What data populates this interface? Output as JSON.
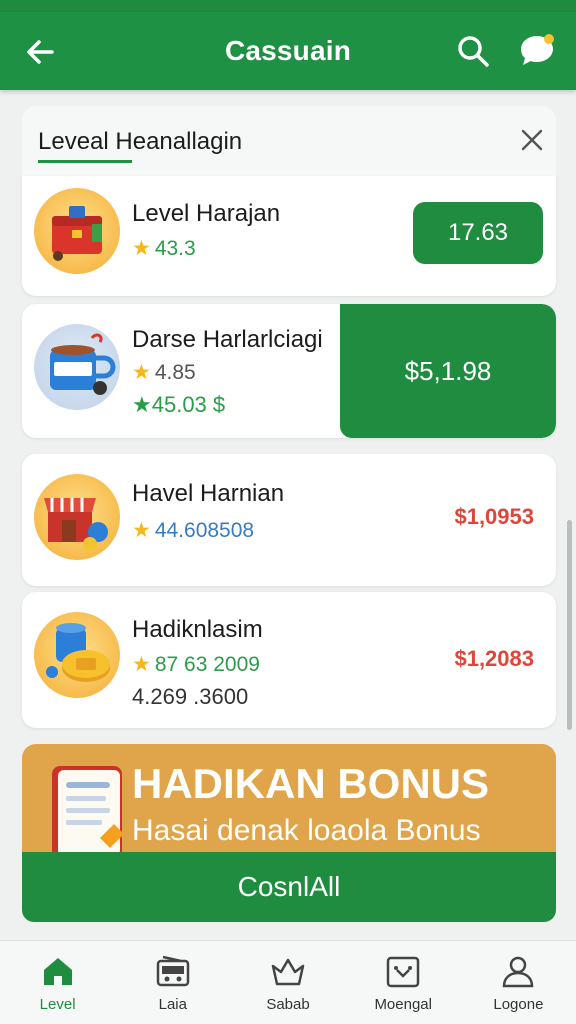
{
  "appbar": {
    "title": "Cassuain"
  },
  "search": {
    "query": "Leveal Heanallagin"
  },
  "items": [
    {
      "name": "Level Harajan",
      "rating": "43.3",
      "price": "17.63"
    },
    {
      "name": "Darse Harlarlciagi",
      "rating": "4.85",
      "sub": "45.03 $",
      "price": "$5,1.98"
    },
    {
      "name": "Havel Harnian",
      "rating": "44.608508",
      "price": "$1,0953"
    },
    {
      "name": "Hadiknlasim",
      "rating": "87 63 2009",
      "sub": "4.269 .3600",
      "price": "$1,2083"
    }
  ],
  "bonus": {
    "title": "HADIKAN BONUS",
    "subtitle": "Hasai denak loaola Bonus"
  },
  "cta": {
    "label": "CosnlAll"
  },
  "nav": [
    {
      "label": "Level",
      "icon": "home-icon"
    },
    {
      "label": "Laia",
      "icon": "radio-icon"
    },
    {
      "label": "Sabab",
      "icon": "crown-icon"
    },
    {
      "label": "Moengal",
      "icon": "calendar-icon"
    },
    {
      "label": "Logone",
      "icon": "user-icon"
    }
  ],
  "colors": {
    "primary": "#1f9144",
    "accent": "#e0a54a",
    "price_red": "#e0453a",
    "star": "#f5b81c"
  }
}
